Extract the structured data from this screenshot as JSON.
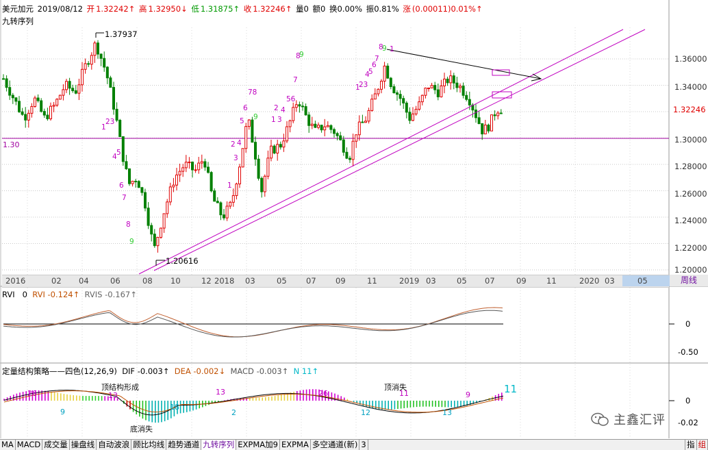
{
  "info": {
    "symbol": "美元加元",
    "date": "2019/08/12",
    "open_label": "开",
    "open": "1.32242↑",
    "high_label": "高",
    "high": "1.32950↓",
    "low_label": "低",
    "low": "1.31875↑",
    "close_label": "收",
    "close": "1.32246↑",
    "volume": "量0",
    "amount": "额0",
    "turnover": "换0.00%",
    "amplitude": "振0.81%",
    "change_label": "涨",
    "change": "(0.00011)0.01%↑"
  },
  "indicator_title": "九转序列",
  "price_axis": [
    "1.36000",
    "1.34000",
    "1.32246",
    "1.30000",
    "1.28000",
    "1.26000",
    "1.24000",
    "1.22000",
    "1.20000"
  ],
  "price_left_label": "1.30",
  "annotations": {
    "high_mark": "1.37937",
    "low_mark": "1.20616"
  },
  "time_axis": [
    "2016",
    "02",
    "04",
    "06",
    "08",
    "10",
    "12",
    "2018",
    "03",
    "05",
    "07",
    "09",
    "11",
    "2019",
    "03",
    "05",
    "07",
    "09",
    "11",
    "2020",
    "03",
    "05"
  ],
  "period_button": "周线",
  "rvi": {
    "name": "RVI",
    "param": "0",
    "rvi_label": "RVI",
    "rvi_value": "-0.124↑",
    "rvis_label": "RVIS",
    "rvis_value": "-0.167↑",
    "axis": [
      "0",
      "-0.50"
    ]
  },
  "macd": {
    "name": "定量结构策略——四色(12,26,9)",
    "dif_label": "DIF",
    "dif": "-0.003↑",
    "dea_label": "DEA",
    "dea": "-0.002↓",
    "macd_label": "MACD",
    "macd_value": "-0.003↑",
    "n_label": "N",
    "n": "11↑",
    "axis": [
      "0",
      "-0.02"
    ],
    "big_count": "11",
    "notes": [
      "顶结构形成",
      "顶消失",
      "底消失"
    ],
    "counts": [
      "26",
      "9",
      "13",
      "18",
      "13",
      "2",
      "26",
      "12",
      "11",
      "13",
      "9"
    ]
  },
  "watermark": "主鑫汇评",
  "tabs": [
    "MA",
    "MACD",
    "成交量",
    "操盘线",
    "自动波浪",
    "顾比均线",
    "趋势通道",
    "九转序列",
    "EXPMA加9",
    "EXPMA",
    "多空通道(新)",
    "3"
  ],
  "corner_labels": [
    "指",
    "组"
  ],
  "seq_labels": [
    {
      "t": "1",
      "c": "#c000c0"
    },
    {
      "t": "23",
      "c": "#c000c0"
    },
    {
      "t": "4",
      "c": "#c000c0"
    },
    {
      "t": "5",
      "c": "#c000c0"
    },
    {
      "t": "6",
      "c": "#c000c0"
    },
    {
      "t": "7",
      "c": "#c000c0"
    },
    {
      "t": "8",
      "c": "#c000c0"
    },
    {
      "t": "9",
      "c": "#33cc33"
    },
    {
      "t": "1",
      "c": "#c000c0"
    },
    {
      "t": "2",
      "c": "#c000c0"
    },
    {
      "t": "3",
      "c": "#c000c0"
    },
    {
      "t": "4",
      "c": "#c000c0"
    },
    {
      "t": "5",
      "c": "#c000c0"
    },
    {
      "t": "6",
      "c": "#c000c0"
    },
    {
      "t": "78",
      "c": "#c000c0"
    },
    {
      "t": "9",
      "c": "#33cc33"
    },
    {
      "t": "1",
      "c": "#c000c0"
    },
    {
      "t": "3",
      "c": "#c000c0"
    },
    {
      "t": "2",
      "c": "#c000c0"
    },
    {
      "t": "4",
      "c": "#c000c0"
    },
    {
      "t": "56",
      "c": "#c000c0"
    },
    {
      "t": "7",
      "c": "#c000c0"
    },
    {
      "t": "8",
      "c": "#c000c0"
    },
    {
      "t": "9",
      "c": "#33cc33"
    },
    {
      "t": "1",
      "c": "#c000c0"
    },
    {
      "t": "23",
      "c": "#c000c0"
    },
    {
      "t": "4",
      "c": "#c000c0"
    },
    {
      "t": "5",
      "c": "#c000c0"
    },
    {
      "t": "6",
      "c": "#c000c0"
    },
    {
      "t": "7",
      "c": "#c000c0"
    },
    {
      "t": "8",
      "c": "#c000c0"
    },
    {
      "t": "9",
      "c": "#33cc33"
    },
    {
      "t": "1",
      "c": "#c000c0"
    }
  ]
}
